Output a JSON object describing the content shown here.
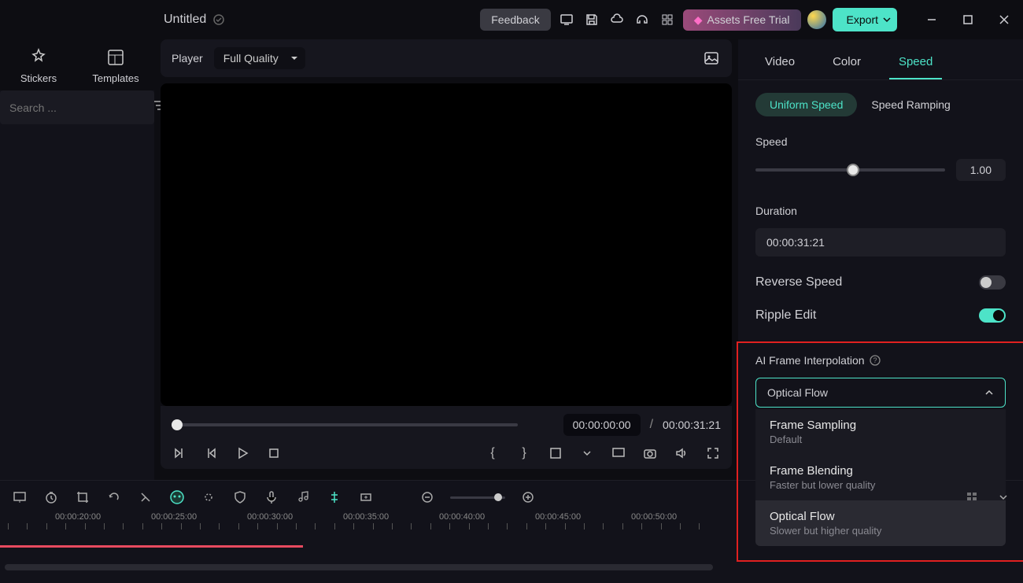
{
  "titlebar": {
    "doc_title": "Untitled",
    "feedback_label": "Feedback",
    "assets_trial_label": "Assets Free Trial",
    "export_label": "Export"
  },
  "leftpanel": {
    "categories": [
      {
        "label": "Stickers"
      },
      {
        "label": "Templates"
      }
    ],
    "search_placeholder": "Search ..."
  },
  "player": {
    "label": "Player",
    "quality": "Full Quality",
    "time_current": "00:00:00:00",
    "time_separator": "/",
    "time_total": "00:00:31:21"
  },
  "rightpanel": {
    "tabs": [
      "Video",
      "Color",
      "Speed"
    ],
    "speed": {
      "uniform_label": "Uniform Speed",
      "ramping_label": "Speed Ramping",
      "speed_label": "Speed",
      "speed_value": "1.00",
      "duration_label": "Duration",
      "duration_value": "00:00:31:21",
      "reverse_label": "Reverse Speed",
      "ripple_label": "Ripple Edit",
      "ai_label": "AI Frame Interpolation",
      "ai_selected": "Optical Flow",
      "ai_options": [
        {
          "title": "Frame Sampling",
          "sub": "Default"
        },
        {
          "title": "Frame Blending",
          "sub": "Faster but lower quality"
        },
        {
          "title": "Optical Flow",
          "sub": "Slower but higher quality"
        }
      ]
    }
  },
  "timeline": {
    "markers": [
      "00:00:20:00",
      "00:00:25:00",
      "00:00:30:00",
      "00:00:35:00",
      "00:00:40:00",
      "00:00:45:00",
      "00:00:50:00"
    ]
  }
}
